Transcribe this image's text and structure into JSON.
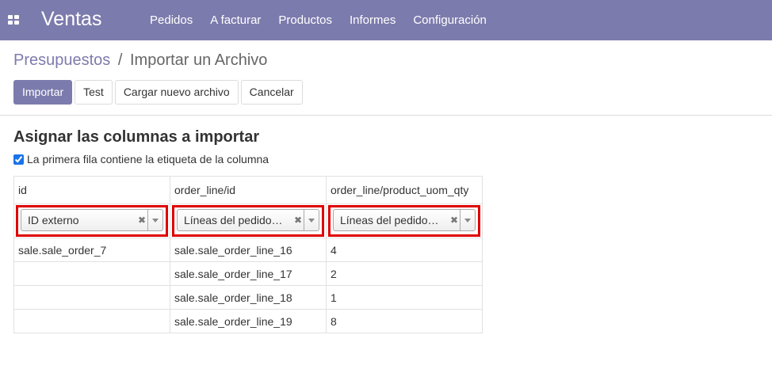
{
  "navbar": {
    "app_name": "Ventas",
    "menu": [
      "Pedidos",
      "A facturar",
      "Productos",
      "Informes",
      "Configuración"
    ]
  },
  "breadcrumb": {
    "parent": "Presupuestos",
    "separator": "/",
    "current": "Importar un Archivo"
  },
  "buttons": {
    "import": "Importar",
    "test": "Test",
    "load_new": "Cargar nuevo archivo",
    "cancel": "Cancelar"
  },
  "section_title": "Asignar las columnas a importar",
  "header_checkbox": {
    "label": "La primera fila contiene la etiqueta de la columna",
    "checked": true
  },
  "table": {
    "columns": [
      "id",
      "order_line/id",
      "order_line/product_uom_qty"
    ],
    "field_selects": [
      "ID externo",
      "Líneas del pedido…",
      "Líneas del pedido…"
    ],
    "rows": [
      [
        "sale.sale_order_7",
        "sale.sale_order_line_16",
        "4"
      ],
      [
        "",
        "sale.sale_order_line_17",
        "2"
      ],
      [
        "",
        "sale.sale_order_line_18",
        "1"
      ],
      [
        "",
        "sale.sale_order_line_19",
        "8"
      ]
    ]
  },
  "colors": {
    "brand": "#7c7bad",
    "highlight": "#e00000"
  }
}
